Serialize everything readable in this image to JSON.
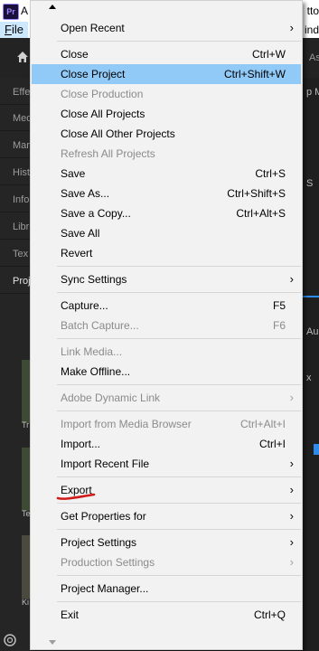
{
  "titlebar": {
    "icon_text": "Pr",
    "title_left": "A",
    "title_right": "tto"
  },
  "menubar": {
    "file_label_first": "F",
    "file_label_rest": "ile",
    "right_fragment": "ind"
  },
  "app_bg": {
    "right_label": "As",
    "left_tabs": [
      "Effe",
      "Med",
      "Mar",
      "Hist",
      "Info",
      "Libr",
      "Tex",
      "Proj"
    ],
    "thumb_labels": [
      "Tr",
      "Te",
      "Ki"
    ],
    "right_labels": [
      "p M",
      "S",
      "Aud",
      "x"
    ]
  },
  "file_menu": {
    "items": [
      {
        "label": "Open Recent",
        "shortcut": "",
        "submenu": true,
        "enabled": true
      },
      {
        "label": "Close",
        "shortcut": "Ctrl+W",
        "submenu": false,
        "enabled": true
      },
      {
        "label": "Close Project",
        "shortcut": "Ctrl+Shift+W",
        "submenu": false,
        "enabled": true,
        "highlighted": true
      },
      {
        "label": "Close Production",
        "shortcut": "",
        "submenu": false,
        "enabled": false
      },
      {
        "label": "Close All Projects",
        "shortcut": "",
        "submenu": false,
        "enabled": true
      },
      {
        "label": "Close All Other Projects",
        "shortcut": "",
        "submenu": false,
        "enabled": true
      },
      {
        "label": "Refresh All Projects",
        "shortcut": "",
        "submenu": false,
        "enabled": false
      },
      {
        "label": "Save",
        "shortcut": "Ctrl+S",
        "submenu": false,
        "enabled": true
      },
      {
        "label": "Save As...",
        "shortcut": "Ctrl+Shift+S",
        "submenu": false,
        "enabled": true
      },
      {
        "label": "Save a Copy...",
        "shortcut": "Ctrl+Alt+S",
        "submenu": false,
        "enabled": true
      },
      {
        "label": "Save All",
        "shortcut": "",
        "submenu": false,
        "enabled": true
      },
      {
        "label": "Revert",
        "shortcut": "",
        "submenu": false,
        "enabled": true
      },
      {
        "label": "Sync Settings",
        "shortcut": "",
        "submenu": true,
        "enabled": true
      },
      {
        "label": "Capture...",
        "shortcut": "F5",
        "submenu": false,
        "enabled": true
      },
      {
        "label": "Batch Capture...",
        "shortcut": "F6",
        "submenu": false,
        "enabled": false
      },
      {
        "label": "Link Media...",
        "shortcut": "",
        "submenu": false,
        "enabled": false
      },
      {
        "label": "Make Offline...",
        "shortcut": "",
        "submenu": false,
        "enabled": true
      },
      {
        "label": "Adobe Dynamic Link",
        "shortcut": "",
        "submenu": true,
        "enabled": false
      },
      {
        "label": "Import from Media Browser",
        "shortcut": "Ctrl+Alt+I",
        "submenu": false,
        "enabled": false
      },
      {
        "label": "Import...",
        "shortcut": "Ctrl+I",
        "submenu": false,
        "enabled": true
      },
      {
        "label": "Import Recent File",
        "shortcut": "",
        "submenu": true,
        "enabled": true
      },
      {
        "label": "Export",
        "shortcut": "",
        "submenu": true,
        "enabled": true
      },
      {
        "label": "Get Properties for",
        "shortcut": "",
        "submenu": true,
        "enabled": true
      },
      {
        "label": "Project Settings",
        "shortcut": "",
        "submenu": true,
        "enabled": true
      },
      {
        "label": "Production Settings",
        "shortcut": "",
        "submenu": true,
        "enabled": false
      },
      {
        "label": "Project Manager...",
        "shortcut": "",
        "submenu": false,
        "enabled": true
      },
      {
        "label": "Exit",
        "shortcut": "Ctrl+Q",
        "submenu": false,
        "enabled": true
      }
    ]
  },
  "colors": {
    "menu_background": "#f2f2f2",
    "highlight": "#91c9f7",
    "disabled_text": "#8b8b8b",
    "annotation_red": "#d11a1a",
    "accent_blue": "#2d8ceb"
  }
}
